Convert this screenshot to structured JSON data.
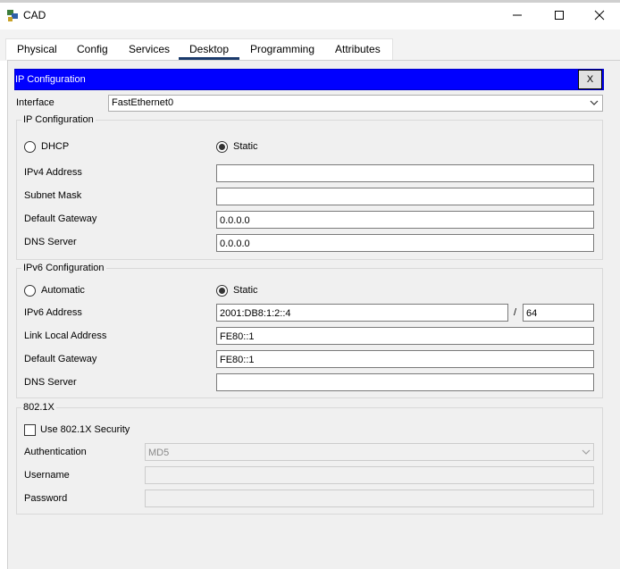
{
  "window": {
    "title": "CAD",
    "minimize_icon": "minimize-icon",
    "maximize_icon": "maximize-icon",
    "close_icon": "close-icon"
  },
  "tabs": [
    {
      "label": "Physical"
    },
    {
      "label": "Config"
    },
    {
      "label": "Services"
    },
    {
      "label": "Desktop",
      "active": true
    },
    {
      "label": "Programming"
    },
    {
      "label": "Attributes"
    }
  ],
  "panel": {
    "title": "IP Configuration",
    "close_label": "X"
  },
  "interface": {
    "label": "Interface",
    "value": "FastEthernet0"
  },
  "ipv4": {
    "group_title": "IP Configuration",
    "dhcp_label": "DHCP",
    "static_label": "Static",
    "mode": "static",
    "ipv4_address": {
      "label": "IPv4 Address",
      "value": ""
    },
    "subnet_mask": {
      "label": "Subnet Mask",
      "value": ""
    },
    "default_gateway": {
      "label": "Default Gateway",
      "value": "0.0.0.0"
    },
    "dns_server": {
      "label": "DNS Server",
      "value": "0.0.0.0"
    }
  },
  "ipv6": {
    "group_title": "IPv6 Configuration",
    "automatic_label": "Automatic",
    "static_label": "Static",
    "mode": "static",
    "ipv6_address": {
      "label": "IPv6 Address",
      "value": "2001:DB8:1:2::4"
    },
    "prefix_separator": "/",
    "prefix_length": "64",
    "link_local_address": {
      "label": "Link Local Address",
      "value": "FE80::1"
    },
    "default_gateway": {
      "label": "Default Gateway",
      "value": "FE80::1"
    },
    "dns_server": {
      "label": "DNS Server",
      "value": ""
    }
  },
  "dot1x": {
    "group_title": "802.1X",
    "use_security_label": "Use 802.1X Security",
    "use_security_checked": false,
    "authentication": {
      "label": "Authentication",
      "value": "MD5"
    },
    "username": {
      "label": "Username",
      "value": ""
    },
    "password": {
      "label": "Password",
      "value": ""
    }
  },
  "colors": {
    "header_bar": "#0000ff",
    "active_tab_underline": "#1a3a6b"
  }
}
